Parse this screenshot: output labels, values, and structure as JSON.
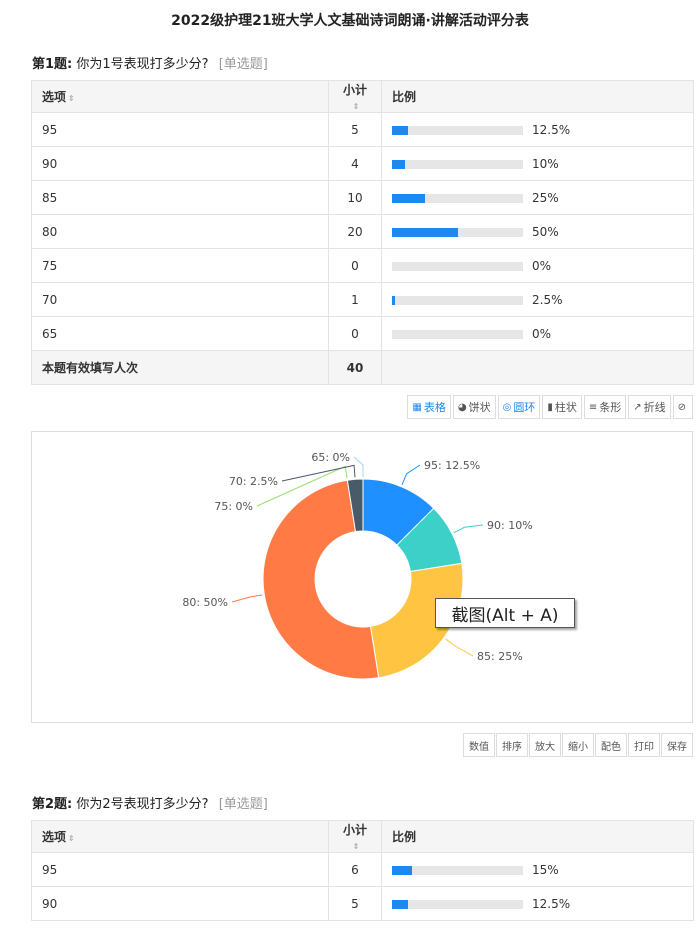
{
  "page_title": "2022级护理21班大学人文基础诗词朗诵·讲解活动评分表",
  "columns": {
    "option": "选项",
    "count": "小计",
    "ratio": "比例",
    "sort_icon": "sort-icon"
  },
  "q1": {
    "no": "第1题:",
    "text": "你为1号表现打多少分?",
    "type": "[单选题]",
    "rows": [
      {
        "option": "95",
        "count": "5",
        "pct": "12.5%",
        "value": 12.5
      },
      {
        "option": "90",
        "count": "4",
        "pct": "10%",
        "value": 10
      },
      {
        "option": "85",
        "count": "10",
        "pct": "25%",
        "value": 25
      },
      {
        "option": "80",
        "count": "20",
        "pct": "50%",
        "value": 50
      },
      {
        "option": "75",
        "count": "0",
        "pct": "0%",
        "value": 0
      },
      {
        "option": "70",
        "count": "1",
        "pct": "2.5%",
        "value": 2.5
      },
      {
        "option": "65",
        "count": "0",
        "pct": "0%",
        "value": 0
      }
    ],
    "total_label": "本题有效填写人次",
    "total": "40"
  },
  "chart_toolbar": [
    {
      "label": "表格",
      "icon": "table-icon",
      "active": true
    },
    {
      "label": "饼状",
      "icon": "pie-icon",
      "active": false
    },
    {
      "label": "圆环",
      "icon": "donut-icon",
      "active": true
    },
    {
      "label": "柱状",
      "icon": "column-icon",
      "active": false
    },
    {
      "label": "条形",
      "icon": "bar-icon",
      "active": false
    },
    {
      "label": "折线",
      "icon": "line-icon",
      "active": false
    },
    {
      "label": "",
      "icon": "hide-icon",
      "active": false
    }
  ],
  "chart_data": {
    "type": "pie",
    "donut": true,
    "slices": [
      {
        "label": "95: 12.5%",
        "value": 12.5,
        "color": "#1e90ff"
      },
      {
        "label": "90: 10%",
        "value": 10,
        "color": "#3cd0c8"
      },
      {
        "label": "85: 25%",
        "value": 25,
        "color": "#ffc542"
      },
      {
        "label": "80: 50%",
        "value": 50,
        "color": "#ff7a45"
      },
      {
        "label": "75: 0%",
        "value": 0,
        "color": "#9be070"
      },
      {
        "label": "70: 2.5%",
        "value": 2.5,
        "color": "#495a6b"
      },
      {
        "label": "65: 0%",
        "value": 0,
        "color": "#9fd4f5"
      }
    ]
  },
  "tooltip": "截图(Alt + A)",
  "small_tools": [
    "数值",
    "排序",
    "放大",
    "缩小",
    "配色",
    "打印",
    "保存"
  ],
  "q2": {
    "no": "第2题:",
    "text": "你为2号表现打多少分?",
    "type": "[单选题]",
    "rows": [
      {
        "option": "95",
        "count": "6",
        "pct": "15%",
        "value": 15
      },
      {
        "option": "90",
        "count": "5",
        "pct": "12.5%",
        "value": 12.5
      }
    ]
  }
}
